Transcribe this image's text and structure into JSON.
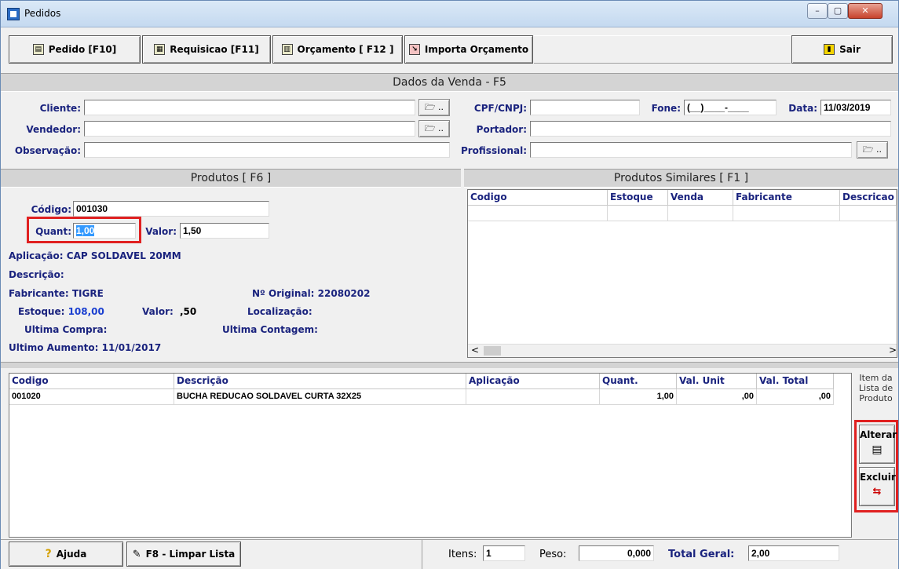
{
  "window": {
    "title": "Pedidos",
    "min": "–",
    "max": "▢",
    "close": "✕"
  },
  "toolbar": {
    "pedido": "Pedido [F10]",
    "requisicao": "Requisicao [F11]",
    "orcamento": "Orçamento [ F12 ]",
    "importa": "Importa Orçamento",
    "sair": "Sair"
  },
  "venda": {
    "header": "Dados da Venda - F5",
    "cliente_label": "Cliente:",
    "cliente": "",
    "vendedor_label": "Vendedor:",
    "vendedor": "",
    "observacao_label": "Observação:",
    "observacao": "",
    "cpf_label": "CPF/CNPJ:",
    "cpf": "",
    "fone_label": "Fone:",
    "fone": "(__)____-____",
    "data_label": "Data:",
    "data": "11/03/2019",
    "portador_label": "Portador:",
    "portador": "",
    "profissional_label": "Profissional:",
    "profissional": "",
    "folder_btn": "🗁 .."
  },
  "produtos": {
    "header": "Produtos [ F6 ]",
    "codigo_label": "Código:",
    "codigo": "001030",
    "quant_label": "Quant:",
    "quant": "1,00",
    "valor_label": "Valor:",
    "valor": "1,50",
    "aplicacao_label": "Aplicação:",
    "aplicacao": "CAP SOLDAVEL 20MM",
    "descricao_label": "Descrição:",
    "descricao": "",
    "fabricante_label": "Fabricante:",
    "fabricante": "TIGRE",
    "original_label": "Nº Original:",
    "original": "22080202",
    "estoque_label": "Estoque:",
    "estoque": "108,00",
    "valor2_label": "Valor:",
    "valor2": ",50",
    "localizacao_label": "Localização:",
    "localizacao": "",
    "ultima_compra_label": "Ultima Compra:",
    "ultima_compra": "",
    "ultima_contagem_label": "Ultima Contagem:",
    "ultima_contagem": "",
    "ultimo_aumento_label": "Ultimo Aumento:",
    "ultimo_aumento": "11/01/2017"
  },
  "similares": {
    "header": "Produtos Similares [ F1 ]",
    "columns": [
      "Codigo",
      "Estoque",
      "Venda",
      "Fabricante",
      "Descricao"
    ],
    "scroll_left": "<",
    "scroll_right": ">"
  },
  "itens": {
    "columns": [
      "Codigo",
      "Descrição",
      "Aplicação",
      "Quant.",
      "Val. Unit",
      "Val. Total"
    ],
    "rows": [
      {
        "codigo": "001020",
        "descricao": "BUCHA REDUCAO SOLDAVEL CURTA  32X25",
        "aplicacao": "",
        "quant": "1,00",
        "val_unit": ",00",
        "val_total": ",00"
      }
    ],
    "side_title": "Item da Lista de Produto",
    "alterar": "Alterar",
    "excluir": "Excluir"
  },
  "footer": {
    "ajuda": "Ajuda",
    "limpar": "F8 - Limpar Lista",
    "itens_label": "Itens:",
    "itens": "1",
    "peso_label": "Peso:",
    "peso": "0,000",
    "total_label": "Total Geral:",
    "total": "2,00"
  },
  "colors": {
    "accent_label": "#1a237e",
    "highlight": "#e02020",
    "selection": "#3399ff"
  },
  "icons": [
    "app-icon",
    "pedido-icon",
    "requisicao-icon",
    "orcamento-icon",
    "importa-icon",
    "sair-icon",
    "folder-icon",
    "help-icon",
    "broom-icon",
    "alterar-icon",
    "excluir-icon"
  ]
}
